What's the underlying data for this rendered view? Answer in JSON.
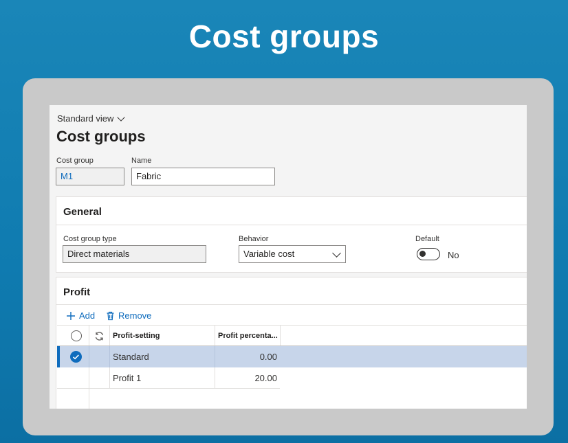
{
  "slide": {
    "title": "Cost groups"
  },
  "app": {
    "view_selector": "Standard view",
    "page_title": "Cost groups",
    "fields": {
      "cost_group": {
        "label": "Cost group",
        "value": "M1"
      },
      "name": {
        "label": "Name",
        "value": "Fabric"
      }
    },
    "general": {
      "header": "General",
      "cost_group_type": {
        "label": "Cost group type",
        "value": "Direct materials"
      },
      "behavior": {
        "label": "Behavior",
        "value": "Variable cost"
      },
      "default": {
        "label": "Default",
        "value": "No",
        "on": false
      }
    },
    "profit": {
      "header": "Profit",
      "add_label": "Add",
      "remove_label": "Remove",
      "columns": [
        "Profit-setting",
        "Profit percenta..."
      ],
      "rows": [
        {
          "setting": "Standard",
          "percent": "0.00",
          "selected": true
        },
        {
          "setting": "Profit 1",
          "percent": "20.00",
          "selected": false
        }
      ]
    }
  },
  "colors": {
    "accent": "#0f6cbd",
    "background": "#1384b7",
    "selected_row": "#c7d5ea"
  }
}
